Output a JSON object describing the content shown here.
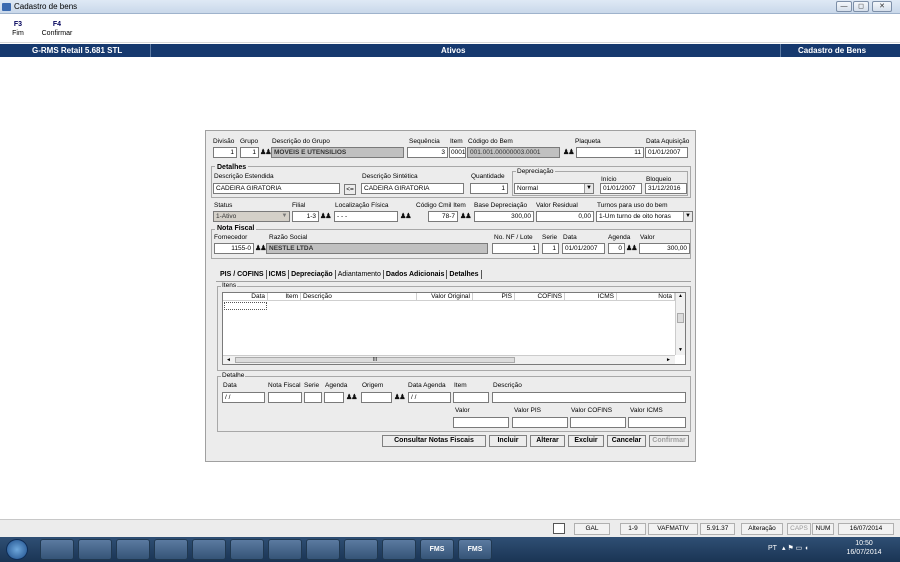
{
  "window": {
    "title": "Cadastro de bens",
    "controls": [
      "—",
      "◻",
      "✕"
    ]
  },
  "toolbar": {
    "keys": [
      {
        "key": "F3",
        "label": "Fim"
      },
      {
        "key": "F4",
        "label": "Confirmar"
      }
    ]
  },
  "statusband": {
    "left": "G-RMS Retail 5.681 STL",
    "center": "Ativos",
    "right": "Cadastro de Bens"
  },
  "form": {
    "row1": {
      "divisao_label": "Divisão",
      "divisao": "1",
      "grupo_label": "Grupo",
      "grupo": "1",
      "desc_grupo_label": "Descrição do Grupo",
      "desc_grupo": "MOVEIS E UTENSILIOS",
      "sequencia_label": "Sequência",
      "sequencia": "3",
      "item_label": "Item",
      "item": "0001",
      "codigo_label": "Código do Bem",
      "codigo": "001.001.00000003.0001",
      "plaqueta_label": "Plaqueta",
      "plaqueta": "11",
      "data_aq_label": "Data Aquisição",
      "data_aq": "01/01/2007"
    },
    "detalhes": {
      "title": "Detalhes",
      "desc_est_label": "Descrição Estendida",
      "desc_est": "CADEIRA GIRATORIA",
      "copy_btn": "<=",
      "desc_sin_label": "Descrição Sintética",
      "desc_sin": "CADEIRA GIRATORIA",
      "qtd_label": "Quantidade",
      "qtd": "1",
      "depr_label": "Depreciação",
      "depr": "Normal",
      "inicio_label": "Início",
      "inicio": "01/01/2007",
      "bloqueio_label": "Bloqueio",
      "bloqueio": "31/12/2016"
    },
    "row3": {
      "status_label": "Status",
      "status": "1-Ativo",
      "filial_label": "Filial",
      "filial": "1-3",
      "loc_label": "Localização Física",
      "loc": "  -  -  -  ",
      "cod_cmil_label": "Código Cmil Item",
      "cod_cmil": "78-7",
      "base_label": "Base Depreciação",
      "base": "300,00",
      "residual_label": "Valor Residual",
      "residual": "0,00",
      "turnos_label": "Turnos para uso do bem",
      "turnos": "1-Um turno de oito horas"
    },
    "nota": {
      "title": "Nota Fiscal",
      "fornecedor_label": "Fornecedor",
      "fornecedor": "1155-0",
      "razao_label": "Razão Social",
      "razao": "NESTLE LTDA",
      "nf_label": "No. NF / Lote",
      "nf": "1",
      "serie_label": "Serie",
      "serie": "1",
      "data_label": "Data",
      "data": "01/01/2007",
      "agenda_label": "Agenda",
      "agenda": "0",
      "valor_label": "Valor",
      "valor": "300,00"
    }
  },
  "tabs": [
    {
      "label": "PIS / COFINS"
    },
    {
      "label": "ICMS"
    },
    {
      "label": "Depreciação"
    },
    {
      "label": "Adiantamento"
    },
    {
      "label": "Dados Adicionais"
    },
    {
      "label": "Detalhes"
    }
  ],
  "itens": {
    "title": "Itens",
    "columns": [
      "Data",
      "Item",
      "Descrição",
      "Valor Original",
      "PIS",
      "COFINS",
      "ICMS",
      "Nota"
    ],
    "hscroll_mid": "III"
  },
  "detalhe": {
    "title": "Detalhe",
    "labels": {
      "data": "Data",
      "nota": "Nota Fiscal",
      "serie": "Serie",
      "agenda": "Agenda",
      "origem": "Origem",
      "data_agenda": "Data Agenda",
      "item": "Item",
      "descricao": "Descrição",
      "valor": "Valor",
      "valor_pis": "Valor PIS",
      "valor_cofins": "Valor COFINS",
      "valor_icms": "Valor ICMS"
    },
    "data": " / /",
    "data_agenda": " / /"
  },
  "buttons": {
    "consultar": "Consultar Notas Fiscais",
    "incluir": "Incluir",
    "alterar": "Alterar",
    "excluir": "Excluir",
    "cancelar": "Cancelar",
    "confirmar": "Confirmar"
  },
  "statusbar": [
    "GAL",
    "1-9",
    "VAFMATIV",
    "5.91.37",
    "Alteração",
    "CAPS",
    "NUM",
    "16/07/2014"
  ],
  "taskbar": {
    "apps": [
      "",
      "",
      "",
      "",
      "",
      "",
      "",
      "",
      "",
      "",
      "FMS",
      "FMS"
    ],
    "lang": "PT",
    "time": "10:50",
    "date": "16/07/2014"
  }
}
